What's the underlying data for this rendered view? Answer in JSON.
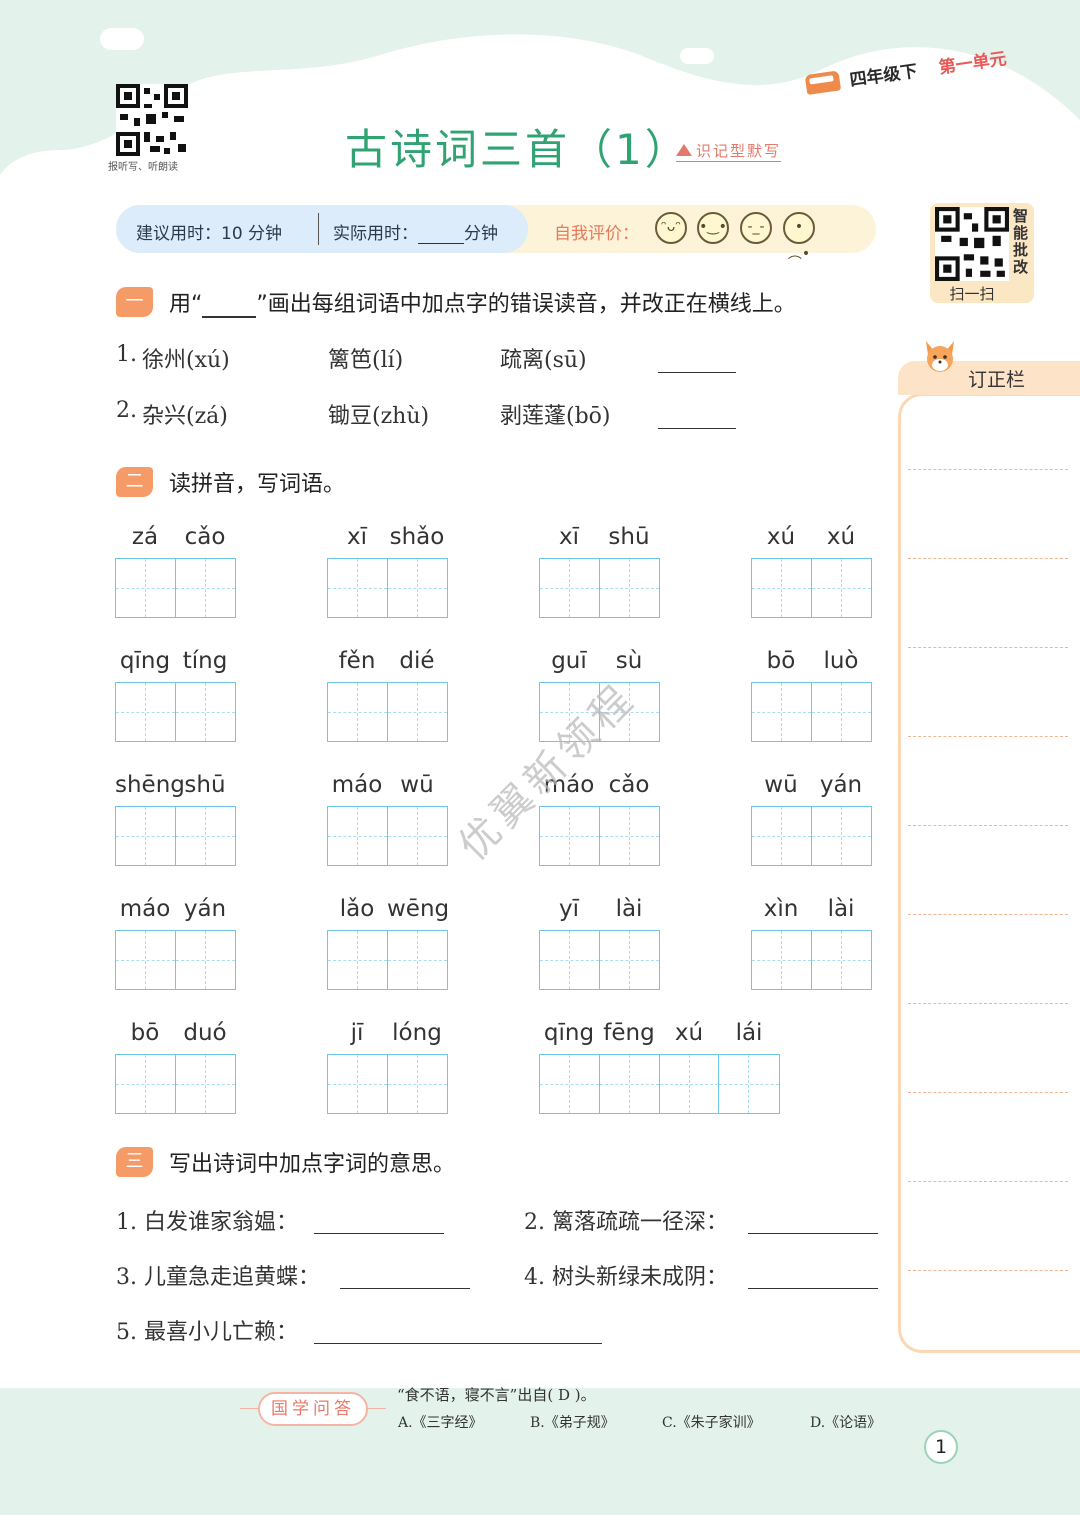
{
  "header": {
    "qr_caption": "报听写、听朗读",
    "grade": "四年级下",
    "unit": "第一单元",
    "title": "古诗词三首（1）",
    "subtitle": "识记型默写"
  },
  "time_bar": {
    "suggested_label": "建议用时：",
    "suggested_value": "10 分钟",
    "actual_label": "实际用时：",
    "actual_unit": "分钟",
    "self_eval_label": "自我评价：",
    "faces": [
      "smile-big-icon",
      "smile-icon",
      "neutral-icon",
      "sad-icon"
    ]
  },
  "smart_qr": {
    "side_text": [
      "智",
      "能",
      "批",
      "改"
    ],
    "caption": "扫一扫"
  },
  "sidebar": {
    "label": "订正栏"
  },
  "section1": {
    "badge": "一",
    "prefix": "用“",
    "suffix": "”画出每组词语中加点字的错误读音，并改正在横线上。",
    "rows": [
      {
        "num": "1.",
        "a": "徐州(xú)",
        "b": "篱笆(lí)",
        "c": "疏离(sū)"
      },
      {
        "num": "2.",
        "a": "杂兴(zá)",
        "b": "锄豆(zhù)",
        "c": "剥莲蓬(bō)"
      }
    ]
  },
  "section2": {
    "badge": "二",
    "heading": "读拼音，写词语。",
    "rows": [
      [
        {
          "pinyin": [
            "zá",
            "cǎo"
          ]
        },
        {
          "pinyin": [
            "xī",
            "shǎo"
          ]
        },
        {
          "pinyin": [
            "xī",
            "shū"
          ]
        },
        {
          "pinyin": [
            "xú",
            "xú"
          ]
        }
      ],
      [
        {
          "pinyin": [
            "qīng",
            "tíng"
          ]
        },
        {
          "pinyin": [
            "fěn",
            "dié"
          ]
        },
        {
          "pinyin": [
            "guī",
            "sù"
          ]
        },
        {
          "pinyin": [
            "bō",
            "luò"
          ]
        }
      ],
      [
        {
          "pinyin": [
            "shēng",
            "shū"
          ]
        },
        {
          "pinyin": [
            "máo",
            "wū"
          ]
        },
        {
          "pinyin": [
            "máo",
            "cǎo"
          ]
        },
        {
          "pinyin": [
            "wū",
            "yán"
          ]
        }
      ],
      [
        {
          "pinyin": [
            "máo",
            "yán"
          ]
        },
        {
          "pinyin": [
            "lǎo",
            "wēng"
          ]
        },
        {
          "pinyin": [
            "yī",
            "lài"
          ]
        },
        {
          "pinyin": [
            "xìn",
            "lài"
          ]
        }
      ],
      [
        {
          "pinyin": [
            "bō",
            "duó"
          ]
        },
        {
          "pinyin": [
            "jī",
            "lóng"
          ]
        },
        {
          "pinyin": [
            "qīng",
            "fēng",
            "xú",
            "lái"
          ]
        }
      ]
    ]
  },
  "section3": {
    "badge": "三",
    "heading": "写出诗词中加点字词的意思。",
    "items": [
      "1. 白发谁家翁媪：",
      "2. 篱落疏疏一径深：",
      "3. 儿童急走追黄蝶：",
      "4. 树头新绿未成阴：",
      "5. 最喜小儿亡赖："
    ]
  },
  "watermark": "优翼新领程",
  "guoxue": {
    "label": "国学问答",
    "question": "“食不语，寝不言”出自( D )。",
    "options": [
      "A.《三字经》",
      "B.《弟子规》",
      "C.《朱子家训》",
      "D.《论语》"
    ]
  },
  "page_number": "1",
  "colors": {
    "title_green": "#2fa372",
    "badge_orange": "#f59b68",
    "grid_blue": "#6ec7e6",
    "bg_mint": "#e3f2ea"
  }
}
